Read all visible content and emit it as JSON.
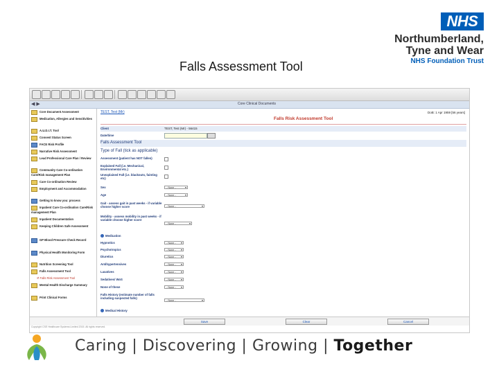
{
  "header": {
    "logo_text": "NHS",
    "trust_line1": "Northumberland,",
    "trust_line2": "Tyne and Wear",
    "trust_line3": "NHS Foundation Trust",
    "slide_title": "Falls Assessment Tool"
  },
  "app": {
    "window_title": "Core Clinical Documents",
    "patient_link": "TEST, Test (Mr)",
    "date_info": "DoB: 1 Apr 1959 [56 years]",
    "form_title": "Falls Risk Assessment Tool",
    "sidebar": [
      {
        "label": "Core Document Assessment",
        "icon": "folder-icon"
      },
      {
        "label": "Medication, Allergies and Sensitivities",
        "icon": "folder-icon"
      },
      {
        "label": "A.U.D.I.T. Tool",
        "icon": "folder-icon"
      },
      {
        "label": "Consent Status Screen",
        "icon": "folder-icon"
      },
      {
        "label": "FACE Risk Profile",
        "icon": "folder-icon"
      },
      {
        "label": "Narrative Risk Assessment",
        "icon": "folder-icon"
      },
      {
        "label": "Lead Professional Care Plan / Review",
        "icon": "folder-icon"
      },
      {
        "label": "Community Care Co-ordination Care/Risk management Plan",
        "icon": "folder-icon"
      },
      {
        "label": "Care Co-ordination Review",
        "icon": "folder-icon"
      },
      {
        "label": "Employment and Accommodation",
        "icon": "folder-icon"
      },
      {
        "label": "Getting to know you: process",
        "icon": "folder-icon"
      },
      {
        "label": "Inpatient Care Co-ordination Care/Risk management Plan",
        "icon": "folder-icon"
      },
      {
        "label": "Inpatient Documentation",
        "icon": "folder-icon"
      },
      {
        "label": "Keeping Children Safe Assessment",
        "icon": "folder-icon"
      },
      {
        "label": "GP Blood Pressure Check Record",
        "icon": "folder-icon"
      },
      {
        "label": "Physical Health Monitoring Form",
        "icon": "folder-icon"
      },
      {
        "label": "Nutrition Screening Tool",
        "icon": "folder-icon"
      },
      {
        "label": "Falls Assessment Tool",
        "icon": "folder-icon"
      },
      {
        "label": "Falls Risk Assessment Tool",
        "icon": "document-icon",
        "sub": true
      },
      {
        "label": "Mental Health Discharge Summary",
        "icon": "folder-icon"
      },
      {
        "label": "Print Clinical Forms",
        "icon": "folder-icon"
      }
    ],
    "form": {
      "client_label": "Client",
      "client_value": "TEST, Test (Mr) - 56415",
      "datetime_label": "Date/time",
      "section1": "Falls Assessment Tool",
      "section2": "Type of Fall (tick as applicable)",
      "checkbox_rows": [
        "Assessment (patient has NOT fallen)",
        "Explained Fall (i.e. Mechanical, Environmental etc.)",
        "Unexplained Fall (i.e. blackouts, fainting etc)"
      ],
      "select_rows": [
        {
          "label": "Sex",
          "value": "- None -"
        },
        {
          "label": "Age",
          "value": "- None -"
        },
        {
          "label": "Gait - assess gait in past weeks - if variable choose higher score",
          "value": "- None -"
        },
        {
          "label": "Mobility - assess mobility in past weeks - if variable choose higher score",
          "value": "- None -"
        }
      ],
      "medication_label": "Medication",
      "med_rows": [
        {
          "label": "Hypnotics",
          "value": "- None -"
        },
        {
          "label": "Psychotropics",
          "value": "- None -"
        },
        {
          "label": "Diuretics",
          "value": "- None -"
        },
        {
          "label": "Antihypertensives",
          "value": "- None -"
        },
        {
          "label": "Laxatives",
          "value": "- None -"
        },
        {
          "label": "Sedatives/ WoS",
          "value": "- None -"
        },
        {
          "label": "None of these",
          "value": "- None -"
        }
      ],
      "history_label": "Falls History (estimate number of falls including suspected falls)",
      "history_value": "- None -",
      "medical_history_label": "Medical History"
    },
    "buttons": {
      "save": "Save",
      "clear": "Clear",
      "cancel": "Cancel"
    },
    "copyright": "Copyright CSE Healthcare Systems Limited 2015. All rights reserved."
  },
  "footer": {
    "word1": "Caring",
    "word2": "Discovering",
    "word3": "Growing",
    "word4": "Together",
    "separator": "|"
  }
}
